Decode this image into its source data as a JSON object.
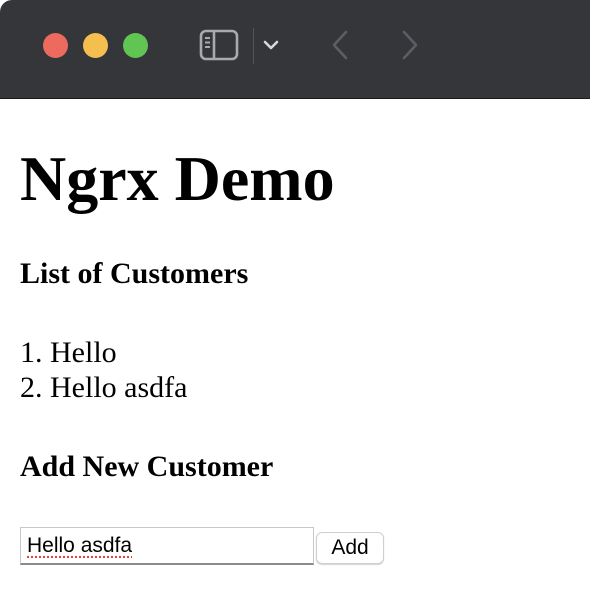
{
  "browser": {
    "traffic_lights": {
      "close_color": "#ed6a5e",
      "minimize_color": "#f5bf4f",
      "zoom_color": "#61c554"
    },
    "toolbar_icons": [
      "sidebar-icon",
      "chevron-down-icon",
      "back-arrow-icon",
      "forward-arrow-icon"
    ],
    "titlebar_color": "#35363a"
  },
  "page": {
    "title": "Ngrx Demo",
    "customers_heading": "List of Customers",
    "customers": [
      {
        "number": "1.",
        "name": "Hello"
      },
      {
        "number": "2.",
        "name": "Hello asdfa"
      }
    ],
    "add_heading": "Add New Customer",
    "form": {
      "input_value": "Hello asdfa",
      "add_label": "Add"
    }
  }
}
